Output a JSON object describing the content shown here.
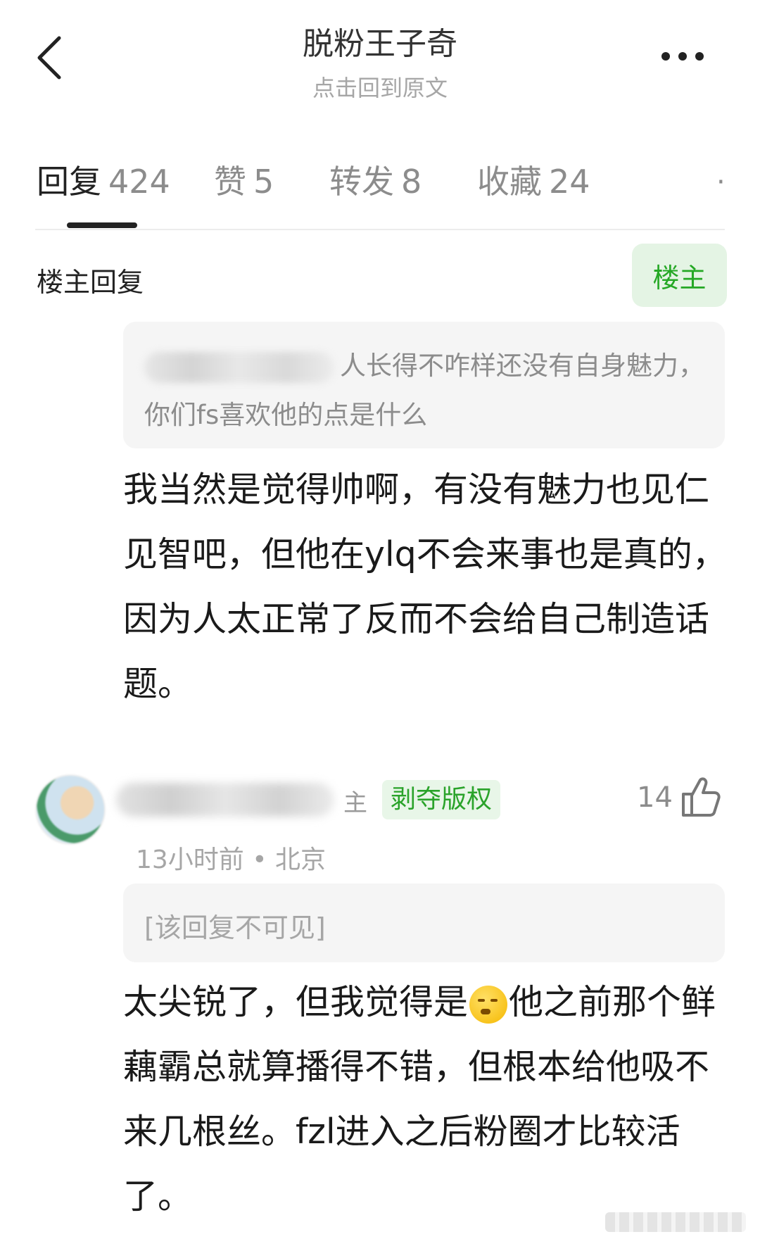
{
  "header": {
    "title": "脱粉王子奇",
    "subtitle": "点击回到原文"
  },
  "tabs": [
    {
      "label": "回复",
      "count": "424",
      "active": true
    },
    {
      "label": "赞",
      "count": "5"
    },
    {
      "label": "转发",
      "count": "8"
    },
    {
      "label": "收藏",
      "count": "24"
    }
  ],
  "op_section": {
    "label": "楼主回复",
    "badge": "楼主",
    "quote": "人长得不咋样还没有自身魅力，你们fs喜欢他的点是什么",
    "reply": "我当然是觉得帅啊，有没有魅力也见仁见智吧，但他在ylq不会来事也是真的，因为人太正常了反而不会给自己制造话题。"
  },
  "comment": {
    "name_suffix": "主",
    "tag": "剥夺版权",
    "likes": "14",
    "time": "13小时前",
    "location": "北京",
    "meta_separator": "•",
    "hidden_reply": "[该回复不可见]",
    "text_before_emoji": "太尖锐了，但我觉得是",
    "emoji": "smirk-emoji",
    "text_after_emoji": "他之前那个鲜藕霸总就算播得不错，但根本给他吸不来几根丝。fzl进入之后粉圈才比较活了。"
  },
  "colors": {
    "accent_green": "#25a825",
    "badge_bg": "#e4f4e4",
    "muted_text": "#8c8c8c",
    "quote_bg": "#f5f5f5"
  }
}
